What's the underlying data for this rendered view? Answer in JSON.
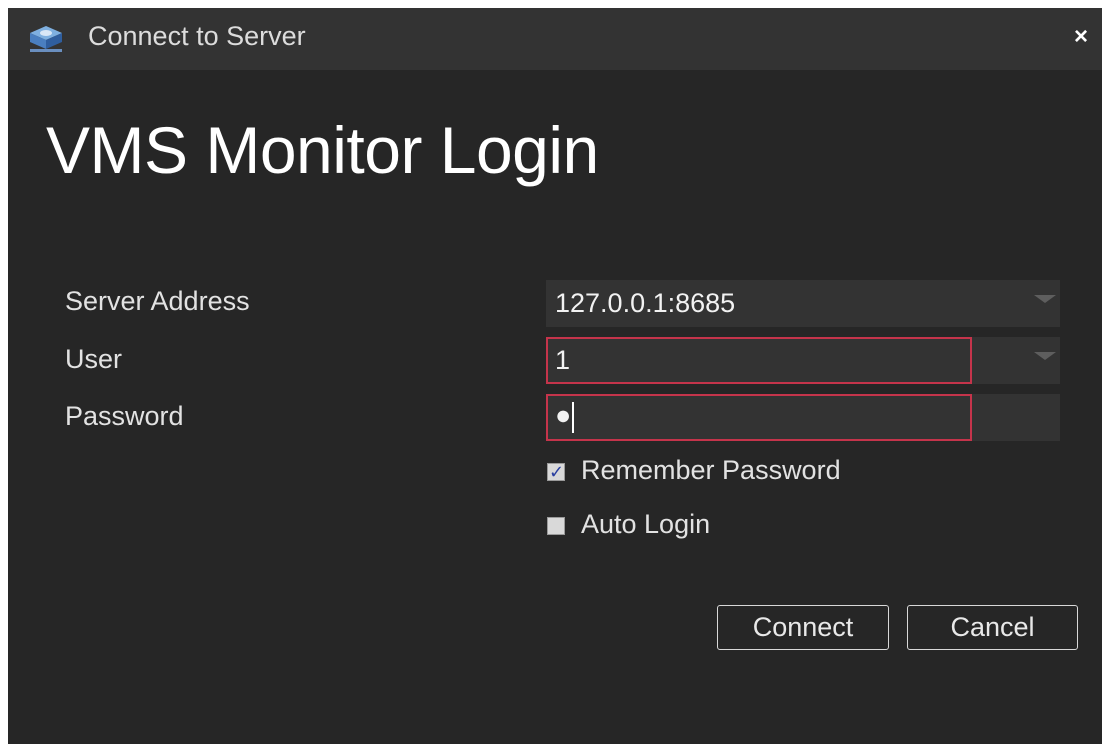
{
  "window": {
    "title": "Connect to Server",
    "close_label": "×"
  },
  "icons": {
    "app_logo": "vms-logo-icon",
    "close": "close-icon",
    "dropdown": "chevron-down-icon",
    "check": "check-icon"
  },
  "heading": "VMS Monitor Login",
  "form": {
    "server_address": {
      "label": "Server Address",
      "value": "127.0.0.1:8685"
    },
    "user": {
      "label": "User",
      "value": "1"
    },
    "password": {
      "label": "Password",
      "masked_value": "●"
    },
    "remember_password": {
      "label": "Remember Password",
      "checked": true,
      "mark": "✓"
    },
    "auto_login": {
      "label": "Auto Login",
      "checked": false
    }
  },
  "buttons": {
    "connect": "Connect",
    "cancel": "Cancel"
  },
  "colors": {
    "background": "#262626",
    "titlebar": "#333333",
    "focus_border": "#c5344b",
    "text": "#e2e2e2"
  }
}
